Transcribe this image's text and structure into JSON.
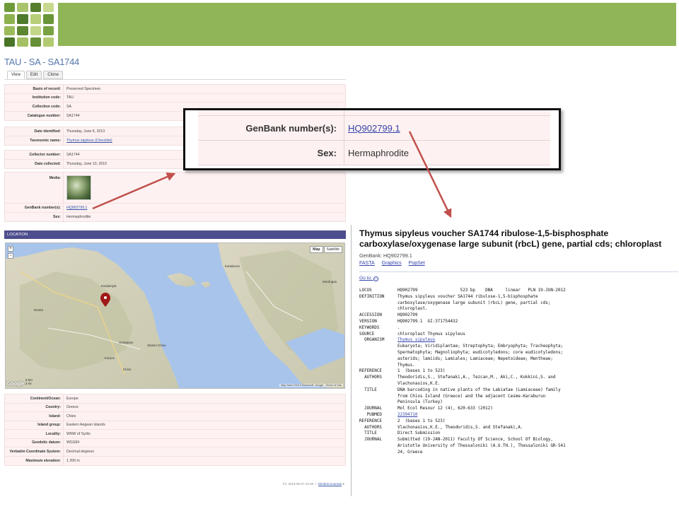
{
  "left_page": {
    "title": "TAU - SA - SA1744",
    "tabs": [
      "View",
      "Edit",
      "Clone"
    ],
    "group1": [
      {
        "label": "Basis of record:",
        "value": "Preserved Specimen"
      },
      {
        "label": "Institution code:",
        "value": "TAU"
      },
      {
        "label": "Collection code:",
        "value": "SA"
      },
      {
        "label": "Catalogue number:",
        "value": "SA1744"
      }
    ],
    "group2": [
      {
        "label": "Date identified:",
        "value": "Thursday, June 6, 2013"
      },
      {
        "label": "Taxonomic name:",
        "value": "Thymus sipyleus (Checklist)"
      }
    ],
    "group3": [
      {
        "label": "Collector number:",
        "value": "SA1744"
      },
      {
        "label": "Date collected:",
        "value": "Thursday, June 10, 2010"
      }
    ],
    "media_label": "Media:",
    "genbank_label": "GenBank number(s):",
    "genbank_value": "HQ902799.1",
    "sex_label": "Sex:",
    "sex_value": "Hermaphrodite",
    "location_header": "LOCATION",
    "map": {
      "btn_map": "Map",
      "btn_satellite": "Satellite",
      "scale": "5 km\n2 mi",
      "credit": "Map Data ©2013 Basarsoft, Google - Terms of Use",
      "google": "Google",
      "labels": [
        "Kardamyla",
        "Chios",
        "Vrontados",
        "Karyes",
        "Stasmi Chiou",
        "Karaburun",
        "Mordogan",
        "Nenita"
      ]
    },
    "group4": [
      {
        "label": "Continent/Ocean:",
        "value": "Europe"
      },
      {
        "label": "Country:",
        "value": "Greece"
      },
      {
        "label": "Island:",
        "value": "Chios"
      },
      {
        "label": "Island group:",
        "value": "Eastern Aegean Islands"
      },
      {
        "label": "Locality:",
        "value": "WNW of Syrtis"
      },
      {
        "label": "Geodetic datum:",
        "value": "WGS84"
      },
      {
        "label": "Verbatim Coordinate System:",
        "value": "Decimal degrees"
      },
      {
        "label": "Maximum elevation:",
        "value": "1 200 m"
      }
    ],
    "footer_date": "Fri, 2013-06-07 10:48 —",
    "footer_user": "Dimitris Koureas"
  },
  "callout": {
    "genbank_label": "GenBank number(s):",
    "genbank_value": "HQ902799.1",
    "sex_label": "Sex:",
    "sex_value": "Hermaphrodite"
  },
  "genbank": {
    "title": "Thymus sipyleus voucher SA1744 ribulose-1,5-bisphosphate carboxylase/oxygenase large subunit (rbcL) gene, partial cds; chloroplast",
    "id": "GenBank: HQ902799.1",
    "links": [
      "FASTA",
      "Graphics",
      "PopSet"
    ],
    "goto": "Go to:",
    "record": [
      [
        "LOCUS",
        "HQ902799                 523 bp    DNA     linear   PLN 19-JUN-2012"
      ],
      [
        "DEFINITION",
        "Thymus sipyleus voucher SA1744 ribulose-1,5-bisphosphate"
      ],
      [
        "",
        "carboxylase/oxygenase large subunit (rbcL) gene, partial cds;"
      ],
      [
        "",
        "chloroplast."
      ],
      [
        "ACCESSION",
        "HQ902799"
      ],
      [
        "VERSION",
        "HQ902799.1  GI:371754432"
      ],
      [
        "KEYWORDS",
        "."
      ],
      [
        "SOURCE",
        "chloroplast Thymus sipyleus"
      ],
      [
        "  ORGANISM",
        "Thymus sipyleus"
      ],
      [
        "",
        "Eukaryota; Viridiplantae; Streptophyta; Embryophyta; Tracheophyta;"
      ],
      [
        "",
        "Spermatophyta; Magnoliophyta; eudicotyledons; core eudicotyledons;"
      ],
      [
        "",
        "asterids; lamiids; Lamiales; Lamiaceae; Nepetoideae; Mentheae;"
      ],
      [
        "",
        "Thymus."
      ],
      [
        "REFERENCE",
        "1  (bases 1 to 523)"
      ],
      [
        "  AUTHORS",
        "Theodoridis,S., Stefanaki,A., Tezcan,M., Aki,C., Kokkini,S. and"
      ],
      [
        "",
        "Vlachonasios,K.E."
      ],
      [
        "  TITLE",
        "DNA barcoding in native plants of the Labiatae (Lamiaceae) family"
      ],
      [
        "",
        "from Chios Island (Greece) and the adjacent Cesme-Karaburun"
      ],
      [
        "",
        "Peninsula (Turkey)"
      ],
      [
        "  JOURNAL",
        "Mol Ecol Resour 12 (4), 620-633 (2012)"
      ],
      [
        "   PUBMED",
        "22394710"
      ],
      [
        "REFERENCE",
        "2  (bases 1 to 523)"
      ],
      [
        "  AUTHORS",
        "Vlachonasios,K.E., Theodoridis,S. and Stefanaki,A."
      ],
      [
        "  TITLE",
        "Direct Submission"
      ],
      [
        "  JOURNAL",
        "Submitted (19-JAN-2011) Faculty Of Science, School Of Biology,"
      ],
      [
        "",
        "Aristotle University of Thessaloniki (A.U.TH.), Thessaloniki GR-541"
      ],
      [
        "",
        "24, Greece"
      ]
    ]
  },
  "colors": {
    "banner": "#8fb556",
    "arrow": "#c0504d",
    "location_header": "#4e4e8e",
    "field_bg": "#fdf1f1"
  }
}
